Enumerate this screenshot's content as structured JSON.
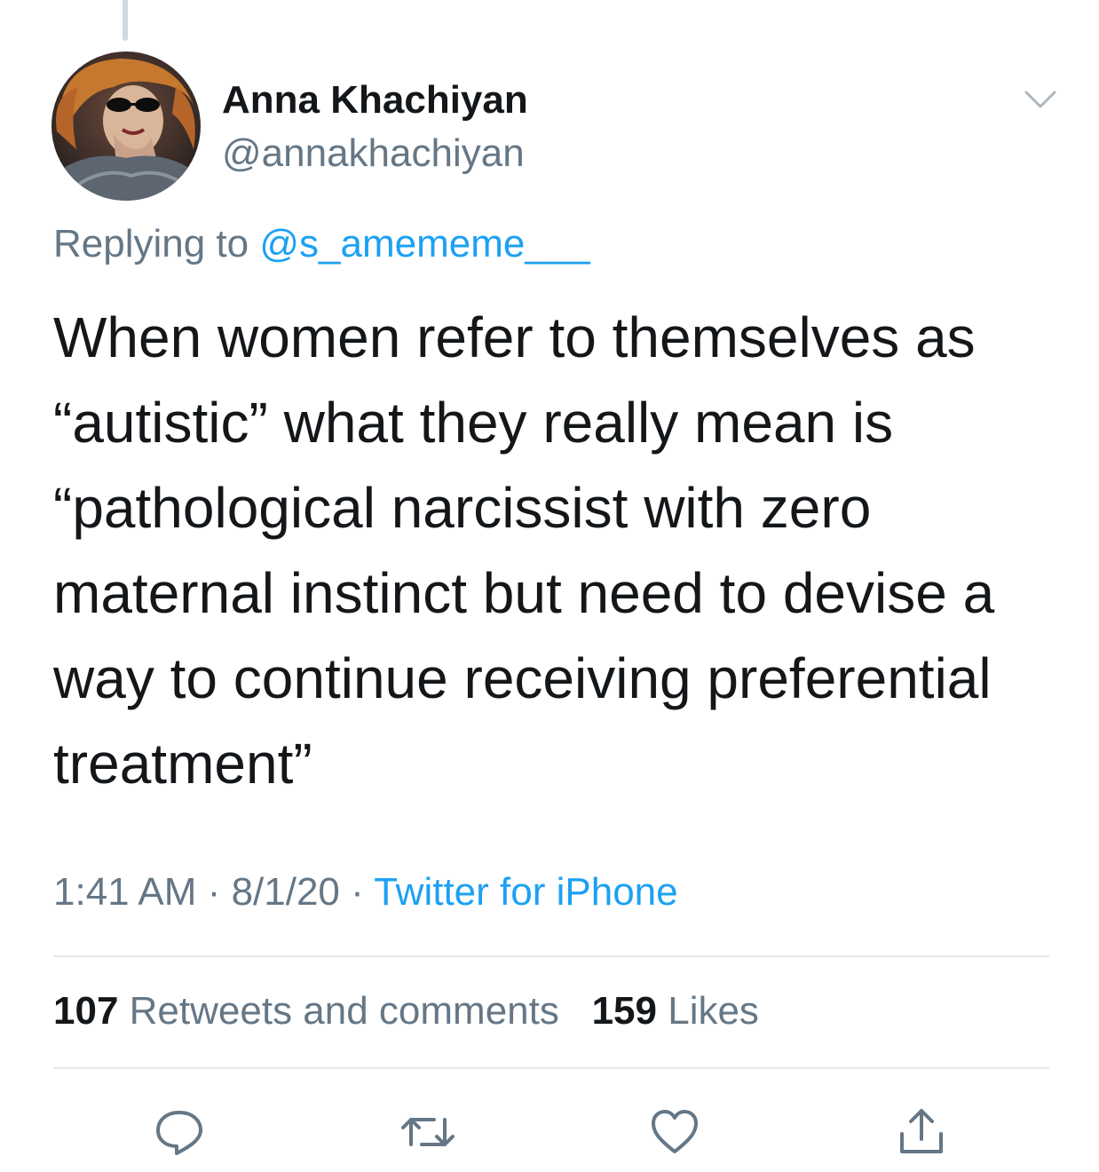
{
  "tweet": {
    "author": {
      "display_name": "Anna Khachiyan",
      "handle": "@annakhachiyan",
      "avatar_icon": "profile-photo"
    },
    "reply": {
      "prefix": "Replying to",
      "to_handle": "@s_amememe___"
    },
    "text": "When women refer to themselves as “autistic” what they really mean is “pathological narcissist with zero maternal instinct but need to devise a way to continue receiving preferential treatment”",
    "meta": {
      "time": "1:41 AM",
      "separator": "·",
      "date": "8/1/20",
      "source": "Twitter for iPhone"
    },
    "stats": {
      "retweets_count": "107",
      "retweets_label": "Retweets and comments",
      "likes_count": "159",
      "likes_label": "Likes"
    }
  },
  "actions": [
    {
      "name": "reply",
      "icon": "speech-bubble-icon"
    },
    {
      "name": "retweet",
      "icon": "retweet-arrows-icon"
    },
    {
      "name": "like",
      "icon": "heart-icon"
    },
    {
      "name": "share",
      "icon": "share-upload-icon"
    }
  ],
  "colors": {
    "text_primary": "#14171a",
    "text_secondary": "#657786",
    "link": "#1da1f2",
    "divider": "#e1e8ed",
    "icon": "#657786"
  }
}
